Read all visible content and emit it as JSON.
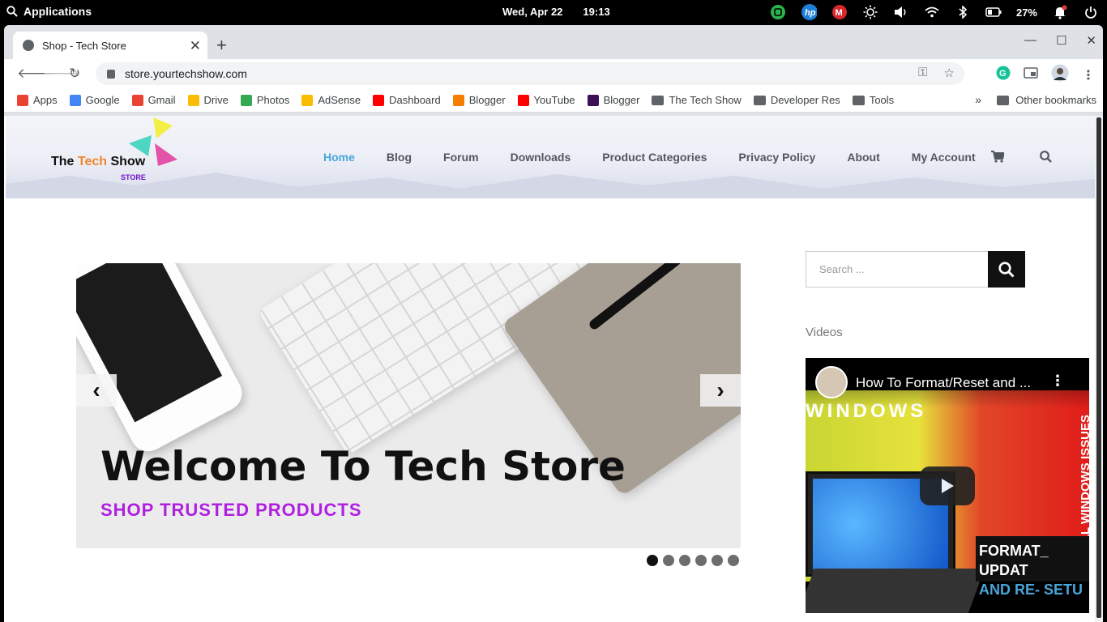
{
  "os": {
    "menu_label": "Applications",
    "date": "Wed, Apr 22",
    "time": "19:13",
    "battery": "27%"
  },
  "browser": {
    "tab_title": "Shop - Tech Store",
    "url": "store.yourtechshow.com",
    "bookmarks": [
      {
        "label": "Apps",
        "icon": "apps-grid-icon",
        "color": "#e94235"
      },
      {
        "label": "Google",
        "icon": "google-icon",
        "color": "#4285f4"
      },
      {
        "label": "Gmail",
        "icon": "gmail-icon",
        "color": "#ea4335"
      },
      {
        "label": "Drive",
        "icon": "drive-icon",
        "color": "#fbbc04"
      },
      {
        "label": "Photos",
        "icon": "photos-icon",
        "color": "#34a853"
      },
      {
        "label": "AdSense",
        "icon": "adsense-icon",
        "color": "#fbbc04"
      },
      {
        "label": "Dashboard",
        "icon": "youtube-icon",
        "color": "#ff0000"
      },
      {
        "label": "Blogger",
        "icon": "blogger-icon",
        "color": "#f57d00"
      },
      {
        "label": "YouTube",
        "icon": "youtube-icon",
        "color": "#ff0000"
      },
      {
        "label": "Blogger",
        "icon": "blogger-dark-icon",
        "color": "#3b1055"
      },
      {
        "label": "The Tech Show",
        "icon": "folder-icon",
        "color": "#5f6368"
      },
      {
        "label": "Developer Res",
        "icon": "folder-icon",
        "color": "#5f6368"
      },
      {
        "label": "Tools",
        "icon": "folder-icon",
        "color": "#5f6368"
      }
    ],
    "other_bookmarks": "Other bookmarks"
  },
  "site": {
    "logo": {
      "the": "The ",
      "tech": "Tech",
      "show": " Show",
      "store": "STORE"
    },
    "nav": [
      "Home",
      "Blog",
      "Forum",
      "Downloads",
      "Product Categories",
      "Privacy Policy",
      "About",
      "My Account"
    ],
    "active_nav": "Home",
    "accent": "#4aa5da",
    "slider": {
      "title": "Welcome To Tech Store",
      "subtitle": "SHOP TRUSTED PRODUCTS",
      "dot_count": 6,
      "active_dot": 1
    },
    "sidebar": {
      "search_placeholder": "Search ...",
      "videos_heading": "Videos",
      "video": {
        "title": "How To Format/Reset and ...",
        "art_text_windows": "WINDOWS",
        "art_text_side": "FIX ALL WINDOWS ISSUES",
        "art_text_format": "FORMAT_ UPDAT",
        "art_text_and": "AND RE- SETU"
      }
    }
  }
}
